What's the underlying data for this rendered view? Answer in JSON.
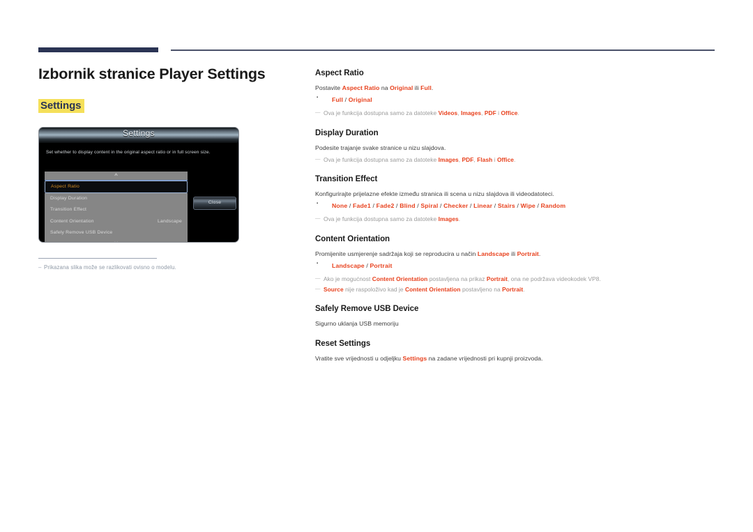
{
  "page": {
    "title": "Izbornik stranice Player Settings",
    "highlight_heading": "Settings",
    "heading_highlight_color": "#f5e05a",
    "accent_color": "#e8421e",
    "rule_color": "#2b3454"
  },
  "device_mock": {
    "titlebar": "Settings",
    "description": "Set whether to display content in the original aspect ratio or in full screen size.",
    "scroll_up_icon": "chevron-up-icon",
    "scroll_down_icon": "chevron-down-icon",
    "close_button": "Close",
    "menu_items": [
      {
        "label": "Aspect Ratio",
        "value": "",
        "selected": true
      },
      {
        "label": "Display Duration",
        "value": "",
        "selected": false
      },
      {
        "label": "Transition Effect",
        "value": "",
        "selected": false
      },
      {
        "label": "Content Orientation",
        "value": "Landscape",
        "selected": false
      },
      {
        "label": "Safely Remove USB Device",
        "value": "",
        "selected": false
      }
    ]
  },
  "image_footnote": {
    "dash": "–",
    "text": "Prikazana slika može se razlikovati ovisno o modelu."
  },
  "sections": [
    {
      "title": "Aspect Ratio",
      "body_html": "Postavite <span class=\"r\">Aspect Ratio</span> na <span class=\"r\">Original</span> ili <span class=\"r\">Full</span>.",
      "options_html": "<span class=\"opts\">Full <span class=\"sep\">/</span> Original</span>",
      "notes_html": [
        "Ova je funkcija dostupna samo za datoteke <span class=\"rn\">Videos</span>, <span class=\"rn\">Images</span>, <span class=\"rn\">PDF</span> i <span class=\"rn\">Office</span>."
      ]
    },
    {
      "title": "Display Duration",
      "body_html": "Podesite trajanje svake stranice u nizu slajdova.",
      "options_html": "",
      "notes_html": [
        "Ova je funkcija dostupna samo za datoteke <span class=\"rn\">Images</span>, <span class=\"rn\">PDF</span>, <span class=\"rn\">Flash</span> i <span class=\"rn\">Office</span>."
      ]
    },
    {
      "title": "Transition Effect",
      "body_html": "Konfigurirajte prijelazne efekte između stranica ili scena u nizu slajdova ili videodatoteci.",
      "options_html": "<span class=\"opts\">None <span class=\"sep\">/</span> Fade1 <span class=\"sep\">/</span> Fade2 <span class=\"sep\">/</span> Blind <span class=\"sep\">/</span> Spiral <span class=\"sep\">/</span> Checker <span class=\"sep\">/</span> Linear <span class=\"sep\">/</span> Stairs <span class=\"sep\">/</span> Wipe <span class=\"sep\">/</span> Random</span>",
      "notes_html": [
        "Ova je funkcija dostupna samo za datoteke <span class=\"rn\">Images</span>."
      ]
    },
    {
      "title": "Content Orientation",
      "body_html": "Promijenite usmjerenje sadržaja koji se reproducira u način <span class=\"r\">Landscape</span> ili <span class=\"r\">Portrait</span>.",
      "options_html": "<span class=\"opts\">Landscape <span class=\"sep\">/</span> Portrait</span>",
      "notes_html": [
        "Ako je mogućnost <span class=\"rn\">Content Orientation</span> postavljena na prikaz <span class=\"rn\">Portrait</span>, ona ne podržava videokodek VP8.",
        "<span class=\"rn\">Source</span> nije raspoloživo kad je <span class=\"rn\">Content Orientation</span> postavljeno na <span class=\"rn\">Portrait</span>."
      ]
    },
    {
      "title": "Safely Remove USB Device",
      "body_html": "Sigurno uklanja USB memoriju",
      "options_html": "",
      "notes_html": []
    },
    {
      "title": "Reset Settings",
      "body_html": "Vratite sve vrijednosti u odjeljku <span class=\"r\">Settings</span> na zadane vrijednosti pri kupnji proizvoda.",
      "options_html": "",
      "notes_html": []
    }
  ]
}
